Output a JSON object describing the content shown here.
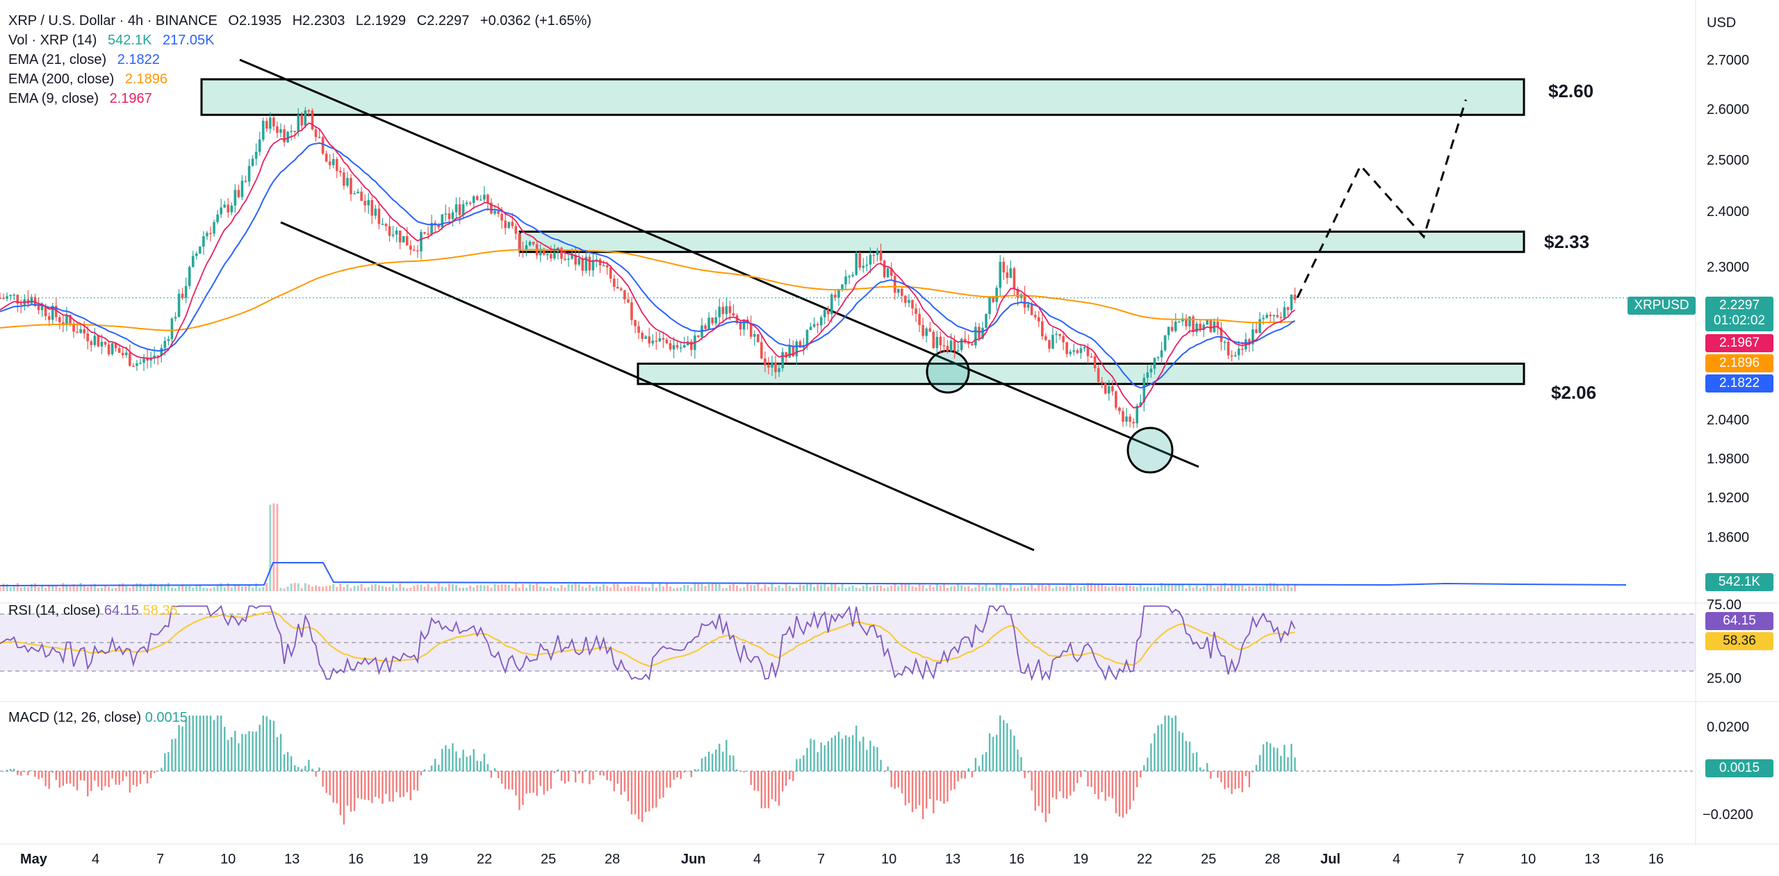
{
  "header": {
    "symbol": "XRP / U.S. Dollar · 4h · BINANCE",
    "o_label": "O",
    "o_value": "2.1935",
    "h_label": "H",
    "h_value": "2.2303",
    "l_label": "L",
    "l_value": "2.1929",
    "c_label": "C",
    "c_value": "2.2297",
    "change": "+0.0362 (+1.65%)"
  },
  "indicators": {
    "vol_label": "Vol · XRP (14)",
    "vol_v1": "542.1K",
    "vol_v2": "217.05K",
    "ema21_label": "EMA (21, close)",
    "ema21_value": "2.1822",
    "ema200_label": "EMA (200, close)",
    "ema200_value": "2.1896",
    "ema9_label": "EMA (9, close)",
    "ema9_value": "2.1967",
    "rsi_label": "RSI (14, close)",
    "rsi_value": "64.15",
    "rsi_ma_value": "58.36",
    "macd_label": "MACD (12, 26, close)",
    "macd_value": "0.0015"
  },
  "currency": "USD",
  "price_axis": [
    "2.7000",
    "2.6000",
    "2.5000",
    "2.4000",
    "2.3000",
    "2.0400",
    "1.9800",
    "1.9200",
    "1.8600"
  ],
  "rsi_axis": [
    "75.00",
    "25.00"
  ],
  "macd_axis": [
    "0.0200",
    "−0.0200"
  ],
  "price_tags": {
    "symbol": "XRPUSD",
    "last": "2.2297",
    "countdown": "01:02:02",
    "ema9": "2.1967",
    "ema200": "2.1896",
    "ema21": "2.1822",
    "volume": "542.1K",
    "rsi": "64.15",
    "rsi_ma": "58.36",
    "macd": "0.0015"
  },
  "zones": [
    "$2.60",
    "$2.33",
    "$2.06"
  ],
  "time_axis": [
    "May",
    "4",
    "7",
    "10",
    "13",
    "16",
    "19",
    "22",
    "25",
    "28",
    "Jun",
    "4",
    "7",
    "10",
    "13",
    "16",
    "19",
    "22",
    "25",
    "28",
    "Jul",
    "4",
    "7",
    "10",
    "13",
    "16"
  ],
  "colors": {
    "up": "#26a69a",
    "down": "#ef5350",
    "ema9": "#e91e63",
    "ema21": "#2962ff",
    "ema200": "#ff9800",
    "rsi": "#7e57c2",
    "rsi_ma": "#f9c930",
    "zone_fill": "#cfeee6",
    "vol_ma": "#2962ff"
  },
  "chart_data": {
    "type": "candlestick",
    "title": "XRP / U.S. Dollar · 4h · BINANCE",
    "x_range": [
      "May 1",
      "Jun 30"
    ],
    "ylim": [
      1.85,
      2.7
    ],
    "support_resistance_zones": [
      {
        "label": "$2.60",
        "low": 2.59,
        "high": 2.66
      },
      {
        "label": "$2.33",
        "low": 2.32,
        "high": 2.36
      },
      {
        "label": "$2.06",
        "low": 2.06,
        "high": 2.1
      }
    ],
    "close_path": [
      {
        "date": "May 1",
        "price": 2.22
      },
      {
        "date": "May 3",
        "price": 2.17
      },
      {
        "date": "May 6",
        "price": 2.1
      },
      {
        "date": "May 7",
        "price": 2.12
      },
      {
        "date": "May 9",
        "price": 2.35
      },
      {
        "date": "May 11",
        "price": 2.45
      },
      {
        "date": "May 12",
        "price": 2.58
      },
      {
        "date": "May 13",
        "price": 2.55
      },
      {
        "date": "May 14",
        "price": 2.6
      },
      {
        "date": "May 15",
        "price": 2.5
      },
      {
        "date": "May 17",
        "price": 2.4
      },
      {
        "date": "May 19",
        "price": 2.33
      },
      {
        "date": "May 21",
        "price": 2.4
      },
      {
        "date": "May 22",
        "price": 2.44
      },
      {
        "date": "May 24",
        "price": 2.34
      },
      {
        "date": "May 26",
        "price": 2.31
      },
      {
        "date": "May 28",
        "price": 2.29
      },
      {
        "date": "May 30",
        "price": 2.15
      },
      {
        "date": "Jun 1",
        "price": 2.13
      },
      {
        "date": "Jun 3",
        "price": 2.22
      },
      {
        "date": "Jun 5",
        "price": 2.09
      },
      {
        "date": "Jun 7",
        "price": 2.16
      },
      {
        "date": "Jun 9",
        "price": 2.3
      },
      {
        "date": "Jun 10",
        "price": 2.31
      },
      {
        "date": "Jun 12",
        "price": 2.18
      },
      {
        "date": "Jun 13",
        "price": 2.13
      },
      {
        "date": "Jun 15",
        "price": 2.16
      },
      {
        "date": "Jun 16",
        "price": 2.3
      },
      {
        "date": "Jun 18",
        "price": 2.15
      },
      {
        "date": "Jun 20",
        "price": 2.12
      },
      {
        "date": "Jun 22",
        "price": 1.97
      },
      {
        "date": "Jun 23",
        "price": 2.09
      },
      {
        "date": "Jun 24",
        "price": 2.18
      },
      {
        "date": "Jun 26",
        "price": 2.17
      },
      {
        "date": "Jun 27",
        "price": 2.1
      },
      {
        "date": "Jun 28",
        "price": 2.17
      },
      {
        "date": "Jun 30",
        "price": 2.2297
      }
    ],
    "projection": [
      {
        "date": "Jun 30",
        "price": 2.23
      },
      {
        "date": "Jul 3",
        "price": 2.49
      },
      {
        "date": "Jul 6",
        "price": 2.35
      },
      {
        "date": "Jul 8",
        "price": 2.62
      }
    ]
  }
}
